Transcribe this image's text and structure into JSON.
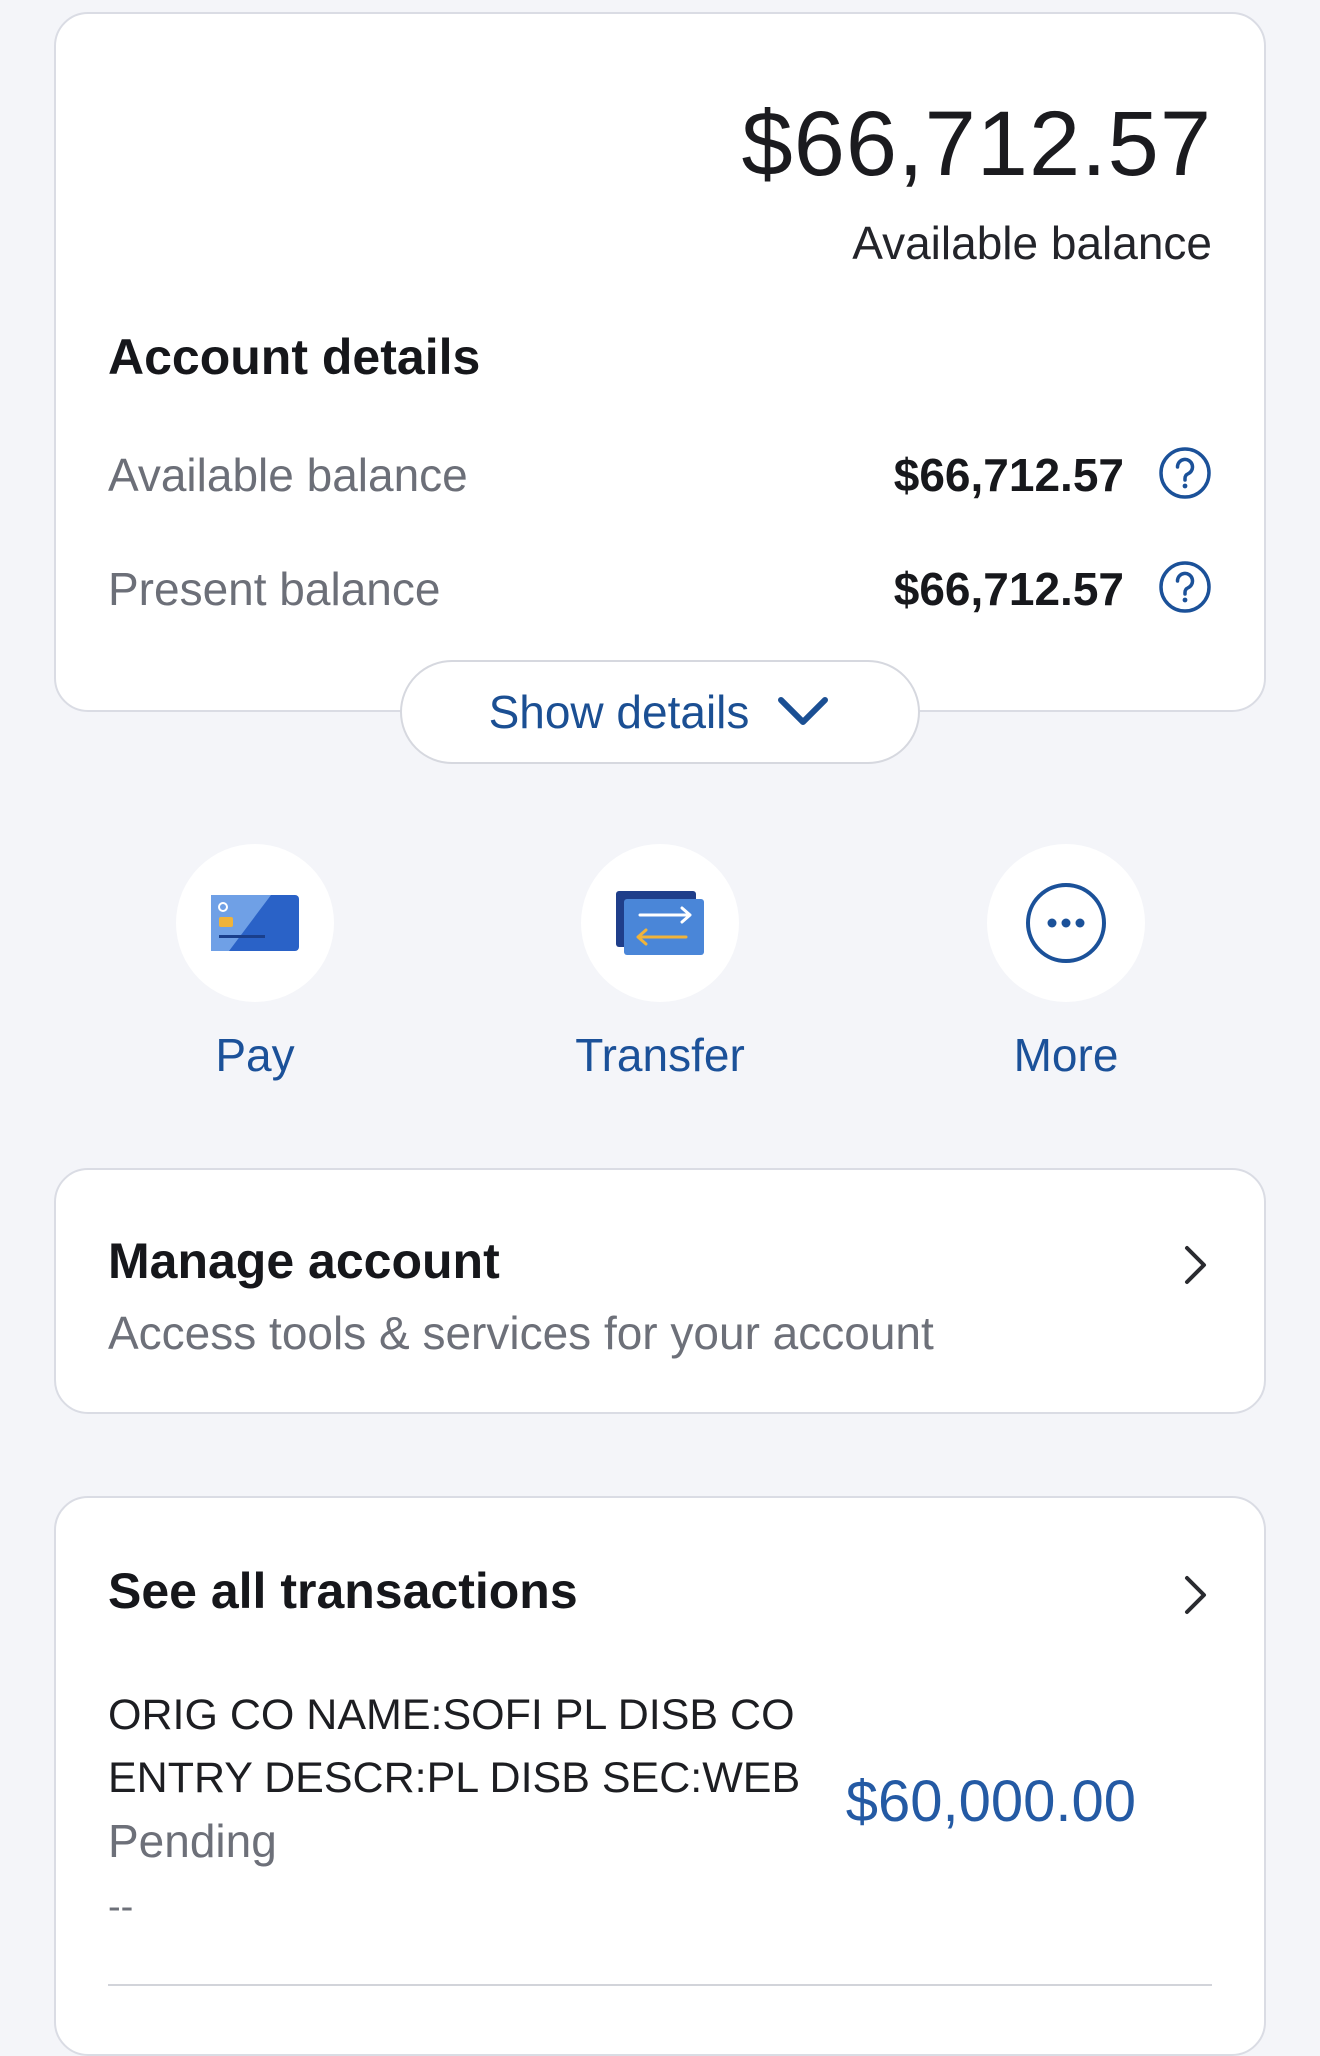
{
  "balance_card": {
    "amount": "$66,712.57",
    "amount_label": "Available balance",
    "details_title": "Account details",
    "rows": [
      {
        "label": "Available balance",
        "value": "$66,712.57"
      },
      {
        "label": "Present balance",
        "value": "$66,712.57"
      }
    ],
    "show_details_label": "Show details"
  },
  "actions": [
    {
      "label": "Pay",
      "icon": "card-icon"
    },
    {
      "label": "Transfer",
      "icon": "transfer-icon"
    },
    {
      "label": "More",
      "icon": "more-icon"
    }
  ],
  "manage_account": {
    "title": "Manage account",
    "subtitle": "Access tools & services for your account"
  },
  "transactions": {
    "title": "See all transactions",
    "items": [
      {
        "line1": "ORIG CO NAME:SOFI PL DISB CO",
        "line2": "ENTRY DESCR:PL DISB SEC:WEB",
        "status": "Pending",
        "detail": "--",
        "amount": "$60,000.00"
      }
    ]
  },
  "colors": {
    "accent": "#1b5199",
    "background": "#f4f5f9",
    "card": "#ffffff",
    "amount_blue": "#245aa4",
    "pay_card_blue": "#2a62c7",
    "transfer_yellow": "#f0b33a"
  }
}
